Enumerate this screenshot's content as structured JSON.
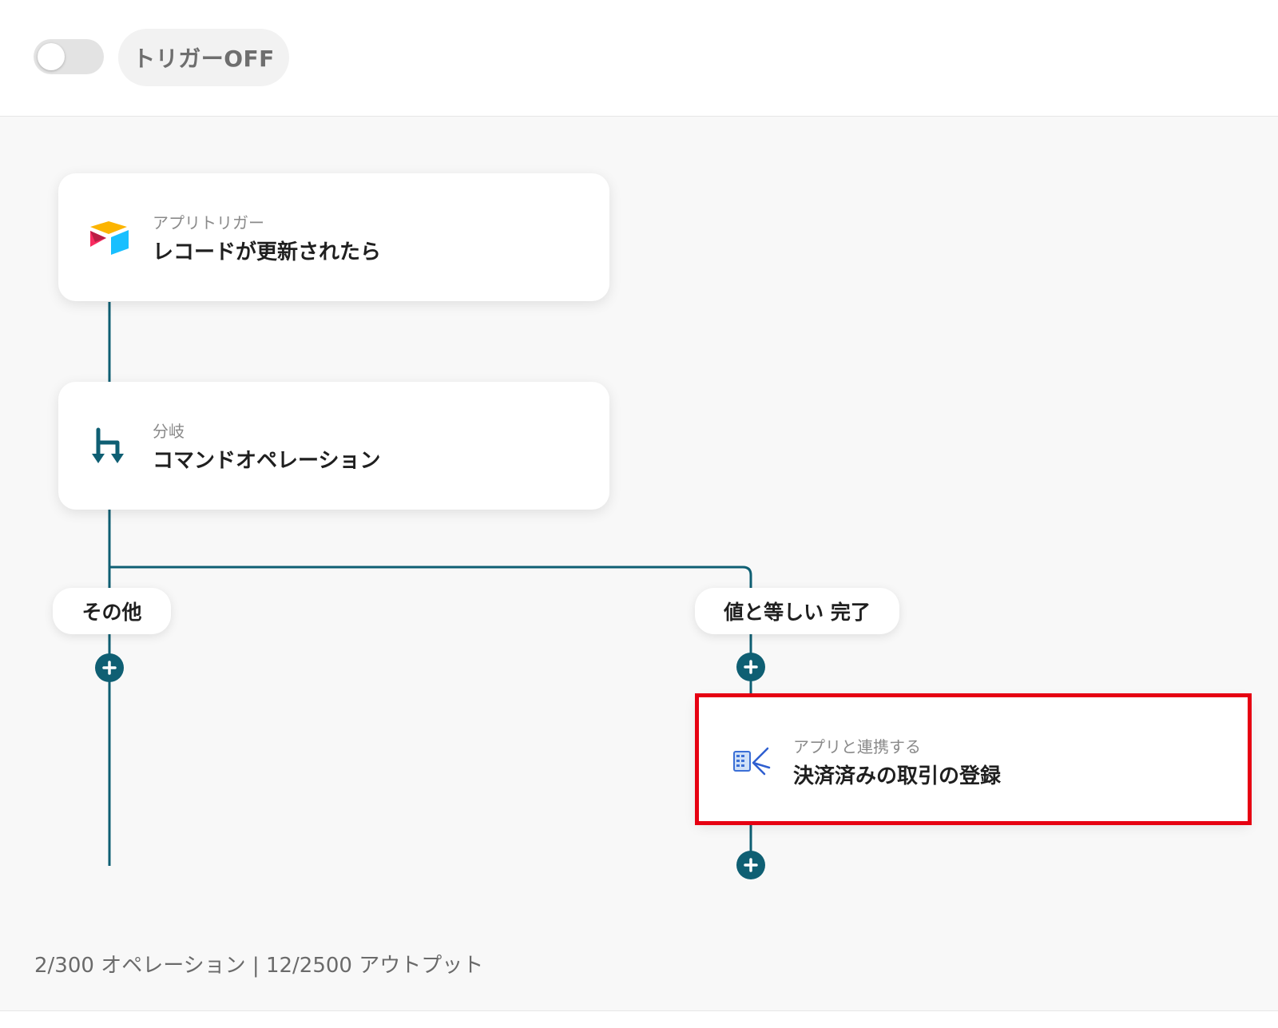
{
  "header": {
    "trigger_toggle_state": "off",
    "trigger_label": "トリガーOFF"
  },
  "flow": {
    "trigger_card": {
      "subtitle": "アプリトリガー",
      "title": "レコードが更新されたら",
      "icon": "airtable-icon"
    },
    "branch_card": {
      "subtitle": "分岐",
      "title": "コマンドオペレーション",
      "icon": "branch-icon"
    },
    "branches": [
      {
        "label": "その他"
      },
      {
        "label": "値と等しい 完了"
      }
    ],
    "action_card": {
      "subtitle": "アプリと連携する",
      "title": "決済済みの取引の登録",
      "icon": "accounting-app-icon"
    },
    "add_step_icon": "plus-icon",
    "colors": {
      "connector": "#0f5f73",
      "highlight": "#e60012"
    }
  },
  "footer": {
    "status": "2/300 オペレーション | 12/2500 アウトプット"
  }
}
